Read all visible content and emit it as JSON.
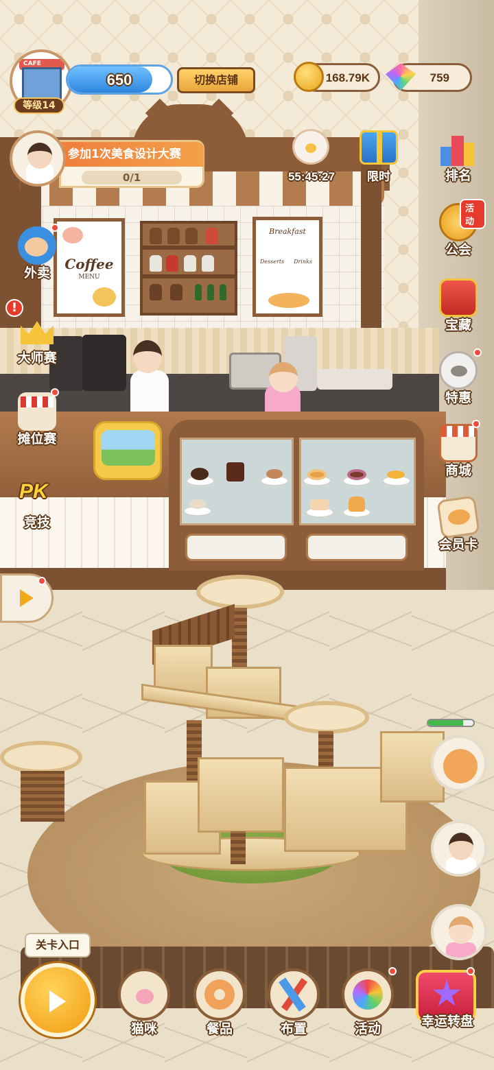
{
  "player": {
    "level_label": "等级14",
    "store_sign": "CAFE",
    "exp_value": "650",
    "exp_fraction": 0.82,
    "switch_store_label": "切换店铺"
  },
  "resources": {
    "coins": "168.79K",
    "gems": "759"
  },
  "quest": {
    "title": "参加1次美食设计大赛",
    "progress": "0/1"
  },
  "top_events": [
    {
      "id": "countdown",
      "label": "55:45:27",
      "icon": "lucky-cat-icon"
    },
    {
      "id": "limited",
      "label": "限时",
      "icon": "gift-box-icon"
    }
  ],
  "left_menu": [
    {
      "id": "delivery",
      "label": "外卖",
      "icon": "delivery-courier-icon"
    },
    {
      "id": "master",
      "label": "大师赛",
      "icon": "crown-icon"
    },
    {
      "id": "stall",
      "label": "摊位赛",
      "icon": "market-stall-icon"
    },
    {
      "id": "pk",
      "label": "竞技",
      "icon": "pk-badge-icon",
      "badge": "PK"
    }
  ],
  "right_menu": [
    {
      "id": "ranking",
      "label": "排名",
      "icon": "podium-icon"
    },
    {
      "id": "guild",
      "label": "公会",
      "icon": "guild-paw-icon",
      "tag": "活动"
    },
    {
      "id": "treasure",
      "label": "宝藏",
      "icon": "treasure-gift-icon"
    },
    {
      "id": "special",
      "label": "特惠",
      "icon": "cat-face-icon"
    },
    {
      "id": "shop",
      "label": "商城",
      "icon": "shop-icon"
    },
    {
      "id": "vip",
      "label": "会员卡",
      "icon": "vip-cat-card-icon"
    }
  ],
  "alert_mark": "!",
  "hp_fraction": 0.78,
  "posters": {
    "coffee_menu_title": "Coffee",
    "coffee_menu_sub": "MENU",
    "breakfast_title": "Breakfast",
    "desserts": "Desserts",
    "drinks": "Drinks"
  },
  "bottom_bar": {
    "stage_entry_tooltip": "关卡入口",
    "buttons": [
      {
        "id": "cats",
        "label": "猫咪",
        "icon": "cat-paw-icon"
      },
      {
        "id": "dishes",
        "label": "餐品",
        "icon": "donut-icon"
      },
      {
        "id": "layout",
        "label": "布置",
        "icon": "pencil-ruler-icon"
      },
      {
        "id": "events",
        "label": "活动",
        "icon": "pinwheel-icon"
      }
    ],
    "lucky_wheel_label": "幸运转盘"
  },
  "colors": {
    "accent_orange": "#f07f3c",
    "exp_blue": "#2f86de",
    "wood_brown": "#8d5c38",
    "notification_red": "#f04a3a"
  }
}
